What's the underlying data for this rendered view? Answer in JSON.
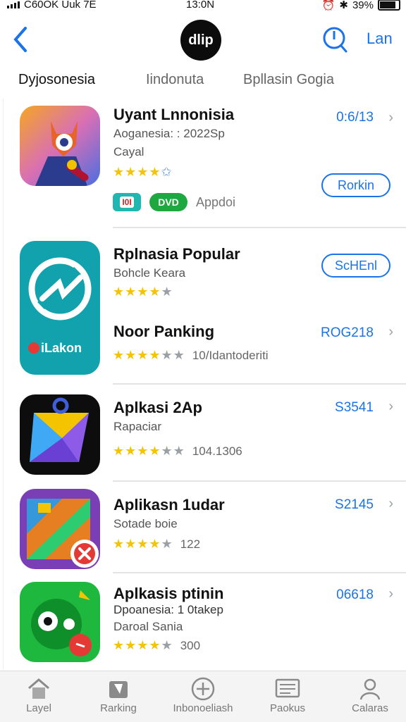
{
  "status": {
    "carrier": "C60OK Uuk 7E",
    "time": "13:0N",
    "battery": "39%"
  },
  "nav": {
    "logo_text": "dlip",
    "right_label": "Lan",
    "back_icon": "chevron-left-icon",
    "search_icon": "search-icon"
  },
  "tabs": [
    {
      "label": "Dyjosonesia",
      "active": true
    },
    {
      "label": "Iindonuta",
      "active": false
    },
    {
      "label": "Bpllasin Gogia",
      "active": false
    }
  ],
  "apps": [
    {
      "title": "Uyant Lnnonisia",
      "subtitle": "Aoganesia: : 2022Sp",
      "line2": "Cayal",
      "rating": "4",
      "count": "",
      "price": "0:6/13",
      "button": "Rorkin",
      "badges": {
        "b1": "I0I",
        "b2": "DVD",
        "b3": "Appdoi"
      }
    },
    {
      "title": "Rplnasia Popular",
      "subtitle": "Bohcle Keara",
      "rating": "4",
      "count": "",
      "price": "",
      "button": "ScHEnl"
    },
    {
      "title": "Noor Panking",
      "subtitle": "",
      "rating": "3.5",
      "count": "10/Idantoderiti",
      "price": "ROG218",
      "button": "",
      "icon_text": "iLakon"
    },
    {
      "title": "Aplkasi 2Ap",
      "subtitle": "Rapaciar",
      "rating": "3.5",
      "count": "104.1306",
      "price": "S3541",
      "button": ""
    },
    {
      "title": "Aplikasn 1udar",
      "subtitle": "Sotade boie",
      "rating": "3.5",
      "count": "122",
      "price": "S2145",
      "button": ""
    },
    {
      "title": "Aplkasis ptinin",
      "subtitle": "Dpoanesia: 1 0takep",
      "line2": "Daroal Sania",
      "rating": "3.5",
      "count": "300",
      "price": "06618",
      "button": ""
    }
  ],
  "tabbar": [
    {
      "label": "Layel",
      "icon": "home-icon"
    },
    {
      "label": "Rarking",
      "icon": "ranking-icon"
    },
    {
      "label": "Inbonoeliash",
      "icon": "plus-circle-icon"
    },
    {
      "label": "Paokus",
      "icon": "list-icon"
    },
    {
      "label": "Calaras",
      "icon": "profile-icon"
    }
  ]
}
